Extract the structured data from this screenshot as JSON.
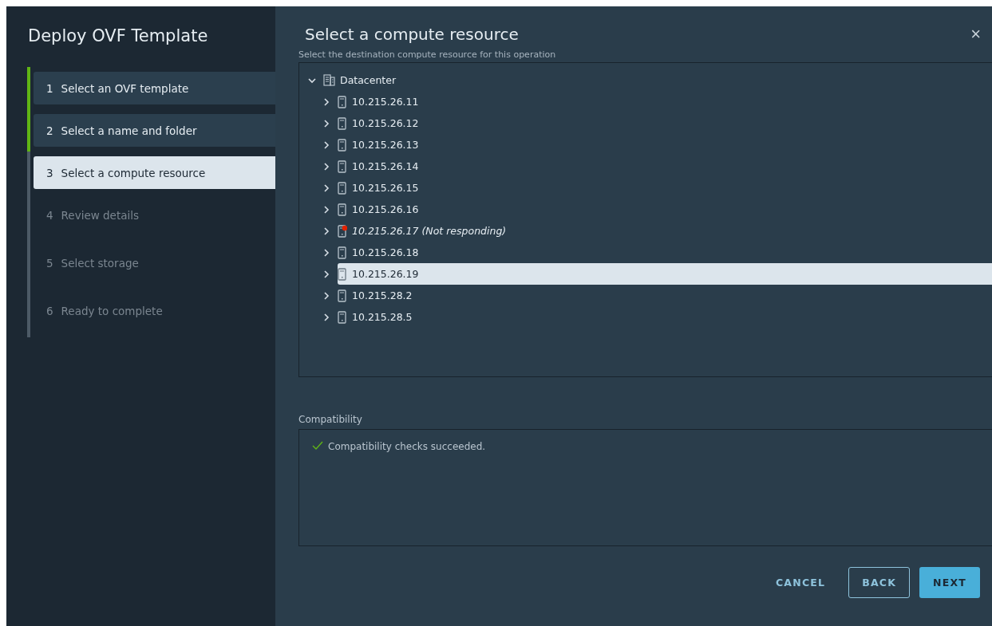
{
  "sidebar": {
    "title": "Deploy OVF Template",
    "steps": [
      {
        "number": "1",
        "label": "Select an OVF template",
        "completed": true,
        "selected": false,
        "disabled": false
      },
      {
        "number": "2",
        "label": "Select a name and folder",
        "completed": true,
        "selected": false,
        "disabled": false
      },
      {
        "number": "3",
        "label": "Select a compute resource",
        "completed": false,
        "selected": true,
        "disabled": false
      },
      {
        "number": "4",
        "label": "Review details",
        "completed": false,
        "selected": false,
        "disabled": true
      },
      {
        "number": "5",
        "label": "Select storage",
        "completed": false,
        "selected": false,
        "disabled": true
      },
      {
        "number": "6",
        "label": "Ready to complete",
        "completed": false,
        "selected": false,
        "disabled": true
      }
    ]
  },
  "main": {
    "title": "Select a compute resource",
    "close": "×",
    "subtitle": "Select the destination compute resource for this operation",
    "tree": [
      {
        "label": "Datacenter",
        "kind": "datacenter",
        "expanded": true,
        "selected": false,
        "children": [
          {
            "label": "10.215.26.11",
            "kind": "host",
            "expanded": false,
            "selected": false,
            "alert": false
          },
          {
            "label": "10.215.26.12",
            "kind": "host",
            "expanded": false,
            "selected": false,
            "alert": false
          },
          {
            "label": "10.215.26.13",
            "kind": "host",
            "expanded": false,
            "selected": false,
            "alert": false
          },
          {
            "label": "10.215.26.14",
            "kind": "host",
            "expanded": false,
            "selected": false,
            "alert": false
          },
          {
            "label": "10.215.26.15",
            "kind": "host",
            "expanded": false,
            "selected": false,
            "alert": false
          },
          {
            "label": "10.215.26.16",
            "kind": "host",
            "expanded": false,
            "selected": false,
            "alert": false
          },
          {
            "label": "10.215.26.17 (Not responding)",
            "kind": "host",
            "expanded": false,
            "selected": false,
            "alert": true
          },
          {
            "label": "10.215.26.18",
            "kind": "host",
            "expanded": false,
            "selected": false,
            "alert": false
          },
          {
            "label": "10.215.26.19",
            "kind": "host",
            "expanded": false,
            "selected": true,
            "alert": false
          },
          {
            "label": "10.215.28.2",
            "kind": "host",
            "expanded": false,
            "selected": false,
            "alert": false
          },
          {
            "label": "10.215.28.5",
            "kind": "host",
            "expanded": false,
            "selected": false,
            "alert": false
          }
        ]
      }
    ],
    "compatibility": {
      "label": "Compatibility",
      "message": "Compatibility checks succeeded.",
      "passed": true
    },
    "buttons": [
      {
        "label": "CANCEL",
        "kind": "flat"
      },
      {
        "label": "BACK",
        "kind": "outline"
      },
      {
        "label": "NEXT",
        "kind": "primary"
      }
    ]
  }
}
